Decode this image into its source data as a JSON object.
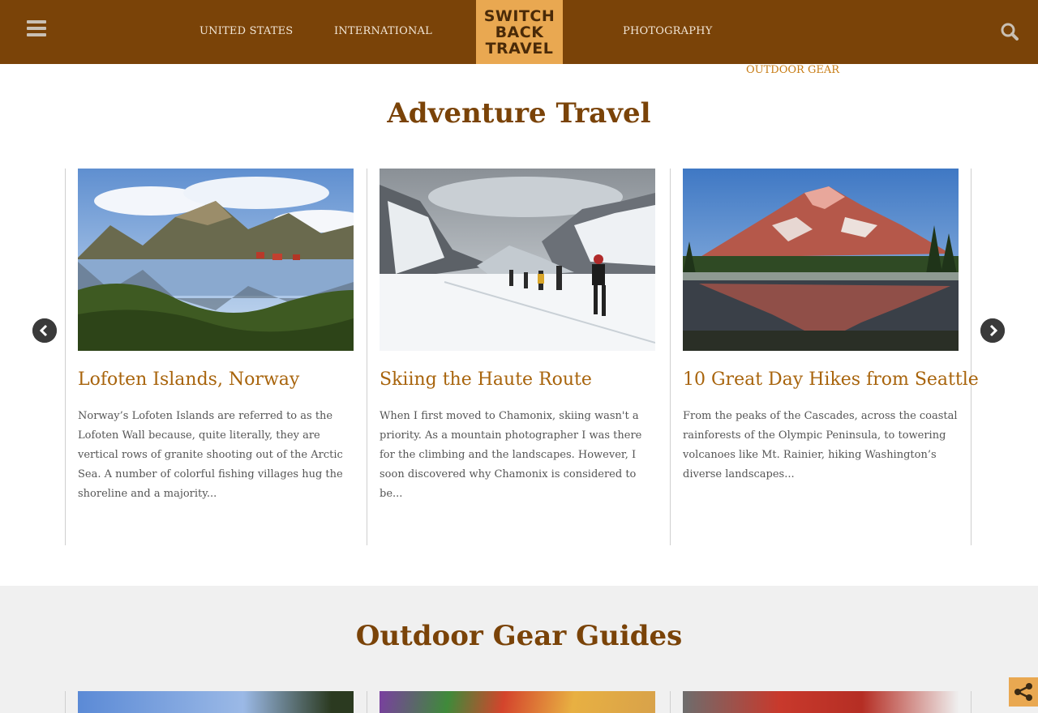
{
  "header": {
    "nav": [
      "UNITED STATES",
      "INTERNATIONAL",
      "PHOTOGRAPHY",
      "OUTDOOR GEAR"
    ],
    "logo_lines": [
      "SWITCH",
      "BACK",
      "TRAVEL"
    ]
  },
  "sections": {
    "adventure_title": "Adventure Travel",
    "gear_title": "Outdoor Gear Guides"
  },
  "cards": [
    {
      "title": "Lofoten Islands, Norway",
      "excerpt": "Norway’s Lofoten Islands are referred to as the Lofoten Wall because, quite literally, they are vertical rows of granite shooting out of the Arctic Sea. A number of colorful fishing villages hug the shoreline and a majority..."
    },
    {
      "title": "Skiing the Haute Route",
      "excerpt": "When I first moved to Chamonix, skiing wasn't a priority. As a mountain photographer I was there for the climbing and the landscapes. However, I soon discovered why Chamonix is considered to be..."
    },
    {
      "title": "10 Great Day Hikes from Seattle",
      "excerpt": "From the peaks of the Cascades, across the coastal rainforests of the Olympic Peninsula, to towering volcanoes like Mt. Rainier, hiking Washington’s diverse landscapes..."
    }
  ],
  "colors": {
    "header_bg": "#7a4308",
    "logo_bg": "#e9a851",
    "title": "#7a4308",
    "card_title": "#a8640c"
  },
  "icons": [
    "menu-icon",
    "search-icon",
    "chevron-left-icon",
    "chevron-right-icon",
    "share-icon"
  ]
}
